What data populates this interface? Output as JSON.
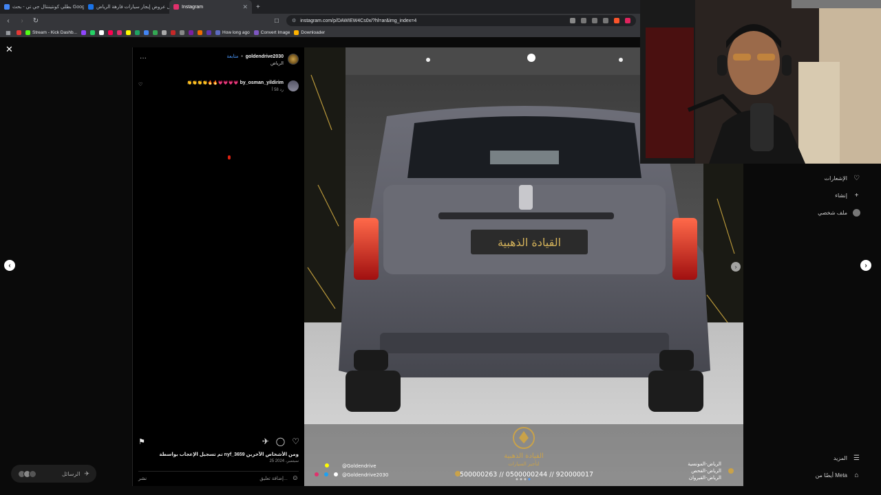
{
  "browser": {
    "tabs": [
      {
        "title": "بطلي كونتيننتال جي تي - بحث Google",
        "color": "#4285f4",
        "active": false
      },
      {
        "title": "افضل عروض إيجار سيارات فارهة الرياض",
        "color": "#1a73e8",
        "active": false
      },
      {
        "title": "Instagram",
        "color": "#e1306c",
        "active": true
      }
    ],
    "new_tab": "+",
    "url": "instagram.com/p/DAWIEW4Cs0x/?hl=ar&img_index=4",
    "bookmarks": [
      {
        "label": "",
        "color": "#e53935"
      },
      {
        "label": "Stream - Kick Dashb...",
        "color": "#53fc18"
      },
      {
        "label": "",
        "color": "#25d366"
      },
      {
        "label": "",
        "color": "#ffffff"
      },
      {
        "label": "",
        "color": "#ff0050"
      },
      {
        "label": "",
        "color": "#e1306c"
      },
      {
        "label": "How long ago",
        "color": "#5c6bc0"
      },
      {
        "label": "Convert Image",
        "color": "#7e57c2"
      },
      {
        "label": "Downloader",
        "color": "#ffb300"
      }
    ]
  },
  "sidebar": {
    "items": [
      {
        "label": "الإشعارات",
        "icon": "heart-icon"
      },
      {
        "label": "إنشاء",
        "icon": "plus-icon"
      },
      {
        "label": "ملف شخصي",
        "icon": "profile-icon"
      }
    ],
    "more": "المزيد",
    "meta": "أيضًا من Meta"
  },
  "messages_pill": {
    "label": "الرسائل"
  },
  "post": {
    "username": "goldendrive2030",
    "follow": "متابعة",
    "separator": "•",
    "location": "الرياض",
    "comment": {
      "username": "by_osman_yildirim",
      "text": "👏👏👏👏🔥🔥💗💗💗💗",
      "time": "58 أ",
      "reply": "رد"
    },
    "likes": "تم تسجيل الإعجاب بواسطة nyf_3659 ومن الأشخاص الآخرين",
    "date": "25 سبتمبر، 2024",
    "add_comment": "إضافة تعليق...",
    "publish": "نشر"
  },
  "image": {
    "plate_text": "القيادة الذهبية",
    "logo_title": "القيادة الذهبية",
    "logo_subtitle": "لتأجير السيارات",
    "social_1": "@Goldendrive",
    "social_2": "@Goldendrive2030",
    "phones": "0500000263 // 0500000244 // 920000017",
    "branches": [
      "الرياض-المونسية",
      "الرياض-الفحص",
      "الرياض-القيروان"
    ]
  },
  "colors": {
    "gold": "#c9a24a",
    "instagram_blue": "#4c9aff"
  }
}
